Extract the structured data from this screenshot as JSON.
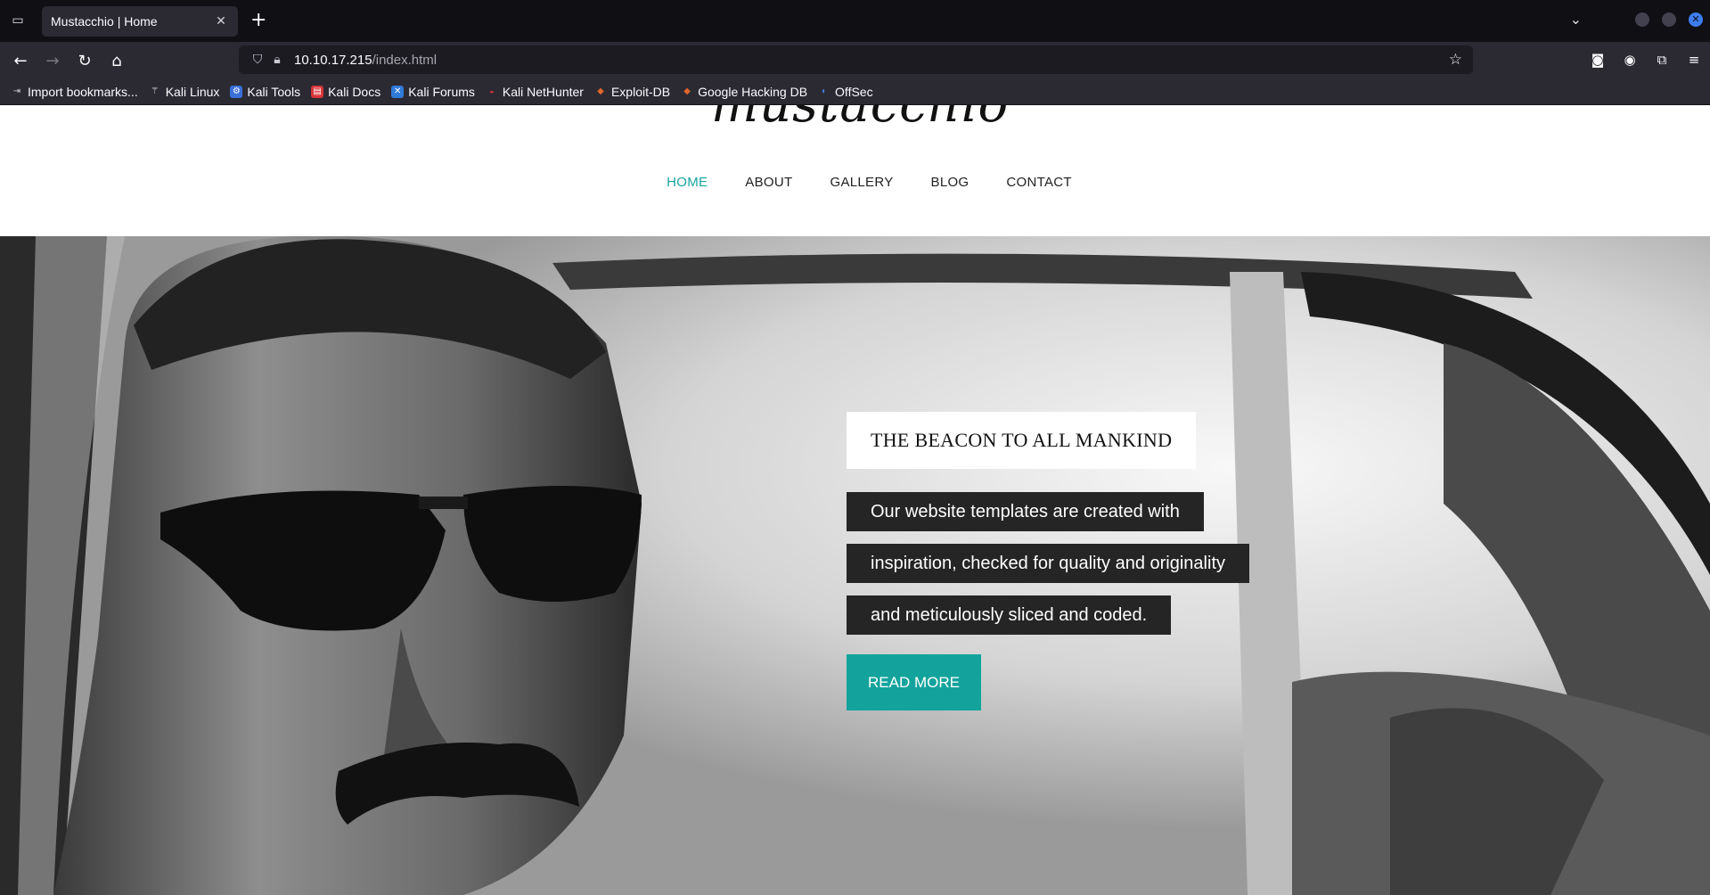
{
  "browser": {
    "tab": {
      "title": "Mustacchio | Home"
    },
    "url": {
      "host": "10.10.17.215",
      "path": "/index.html"
    },
    "bookmarks": [
      {
        "label": "Import bookmarks...",
        "icon": "import-icon",
        "color": "#cfcfd6"
      },
      {
        "label": "Kali Linux",
        "icon": "kali-dragon-icon",
        "color": "#1d1d1d"
      },
      {
        "label": "Kali Tools",
        "icon": "kali-tools-icon",
        "color": "#3a6fd8"
      },
      {
        "label": "Kali Docs",
        "icon": "kali-docs-icon",
        "color": "#d8343a"
      },
      {
        "label": "Kali Forums",
        "icon": "kali-forums-icon",
        "color": "#2f7bd8"
      },
      {
        "label": "Kali NetHunter",
        "icon": "nethunter-icon",
        "color": "#d8343a"
      },
      {
        "label": "Exploit-DB",
        "icon": "exploit-db-icon",
        "color": "#e0662a"
      },
      {
        "label": "Google Hacking DB",
        "icon": "ghdb-icon",
        "color": "#e0662a"
      },
      {
        "label": "OffSec",
        "icon": "offsec-icon",
        "color": "#4a7be0"
      }
    ]
  },
  "site": {
    "logo": "mustacchio",
    "nav": [
      {
        "label": "HOME",
        "active": true
      },
      {
        "label": "ABOUT",
        "active": false
      },
      {
        "label": "GALLERY",
        "active": false
      },
      {
        "label": "BLOG",
        "active": false
      },
      {
        "label": "CONTACT",
        "active": false
      }
    ],
    "hero": {
      "title": "THE BEACON TO ALL MANKIND",
      "lines": [
        "Our website templates are created with",
        "inspiration, checked for quality and originality",
        "and meticulously sliced and coded."
      ],
      "button": "READ MORE"
    },
    "accent_color": "#13a39c"
  }
}
